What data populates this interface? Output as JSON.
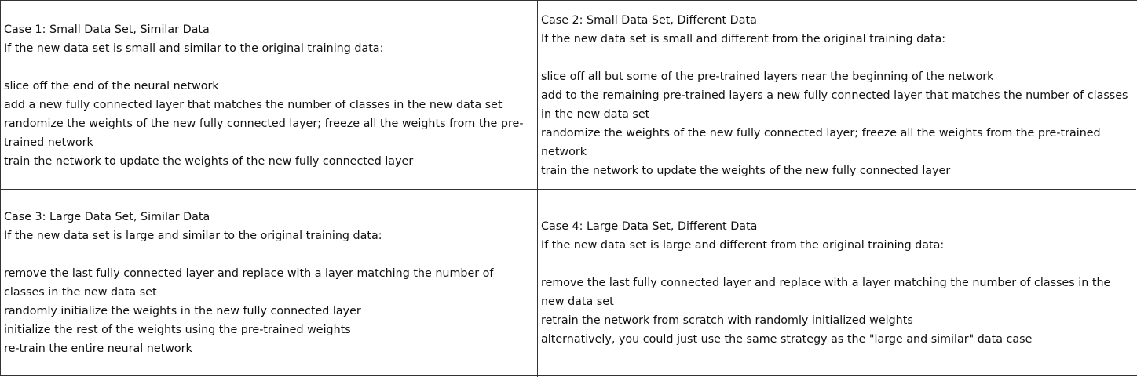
{
  "cases": [
    {
      "title": "Case 1: Small Data Set, Similar Data",
      "intro": "If the new data set is small and similar to the original training data:",
      "steps": [
        "slice off the end of the neural network",
        "add a new fully connected layer that matches the number of classes in the new data set",
        "randomize the weights of the new fully connected layer; freeze all the weights from the pre-trained network",
        "train the network to update the weights of the new fully connected layer"
      ]
    },
    {
      "title": "Case 2: Small Data Set, Different Data",
      "intro": "If the new data set is small and different from the original training data:",
      "steps": [
        "slice off all but some of the pre-trained layers near the beginning of the network",
        "add to the remaining pre-trained layers a new fully connected layer that matches the number of classes in the new data set",
        "randomize the weights of the new fully connected layer; freeze all the weights from the pre-trained network",
        "train the network to update the weights of the new fully connected layer"
      ]
    },
    {
      "title": "Case 3: Large Data Set, Similar Data",
      "intro": "If the new data set is large and similar to the original training data:",
      "steps": [
        "remove the last fully connected layer and replace with a layer matching the number of classes in the new data set",
        "randomly initialize the weights in the new fully connected layer",
        "initialize the rest of the weights using the pre-trained weights",
        "re-train the entire neural network"
      ]
    },
    {
      "title": "Case 4: Large Data Set, Different Data",
      "intro": "If the new data set is large and different from the original training data:",
      "steps": [
        "remove the last fully connected layer and replace with a layer matching the number of classes in the new data set",
        "retrain the network from scratch with randomly initialized weights",
        "alternatively, you could just use the same strategy as the \"large and similar\" data case"
      ]
    }
  ]
}
